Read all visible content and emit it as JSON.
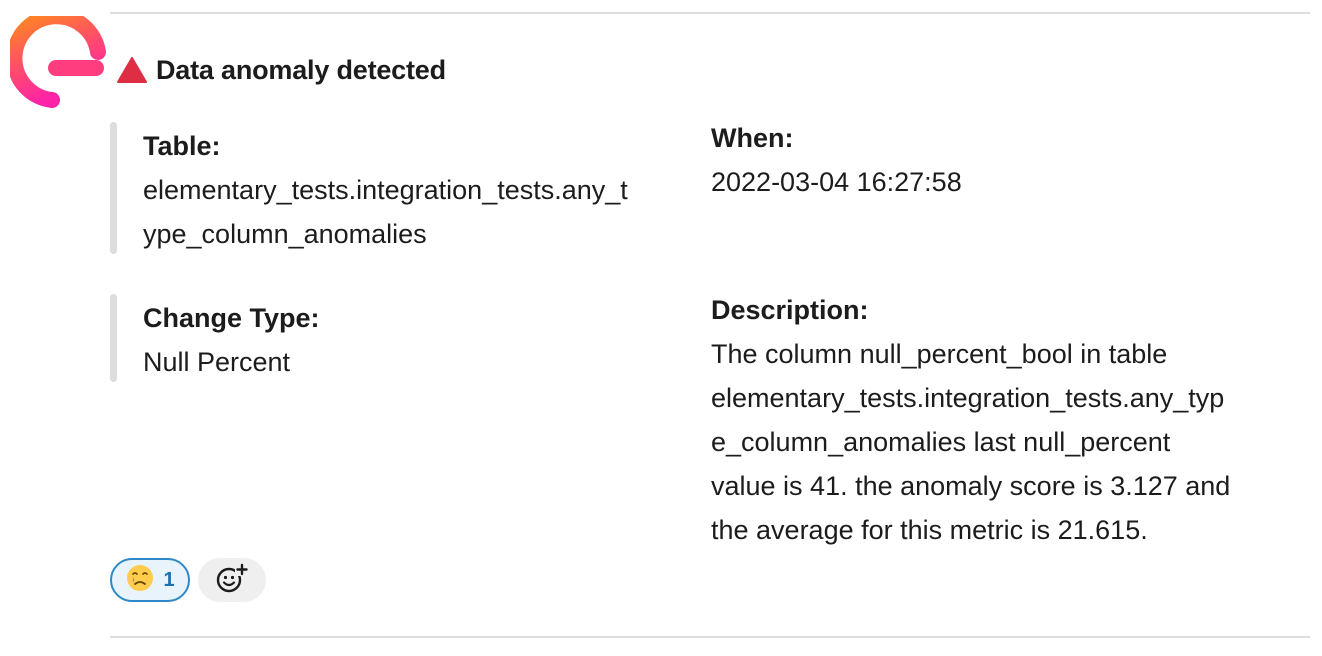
{
  "message": {
    "title": "Data anomaly detected",
    "fields": {
      "table": {
        "label": "Table:",
        "value_line1": "elementary_tests.integration_tests.any_t",
        "value_line2": "ype_column_anomalies"
      },
      "when": {
        "label": "When:",
        "value": "2022-03-04 16:27:58"
      },
      "change_type": {
        "label": "Change Type:",
        "value": "Null Percent"
      },
      "description": {
        "label": "Description:",
        "lines": [
          "The column null_percent_bool in table",
          "elementary_tests.integration_tests.any_typ",
          "e_column_anomalies last null_percent",
          "value is 41. the anomaly score is 3.127 and",
          "the average for this metric is 21.615."
        ]
      }
    }
  },
  "reactions": {
    "items": [
      {
        "emoji": "crying-face-icon",
        "count": "1",
        "selected": true
      }
    ],
    "add_icon": "add-reaction-icon"
  },
  "colors": {
    "logo_orange": "#ff7a1a",
    "logo_pink": "#ff2d87",
    "warning_red": "#dd2e44",
    "reaction_border": "#2f88c8",
    "reaction_bg": "#e8f3fb",
    "quote_bar": "#dddddd"
  }
}
